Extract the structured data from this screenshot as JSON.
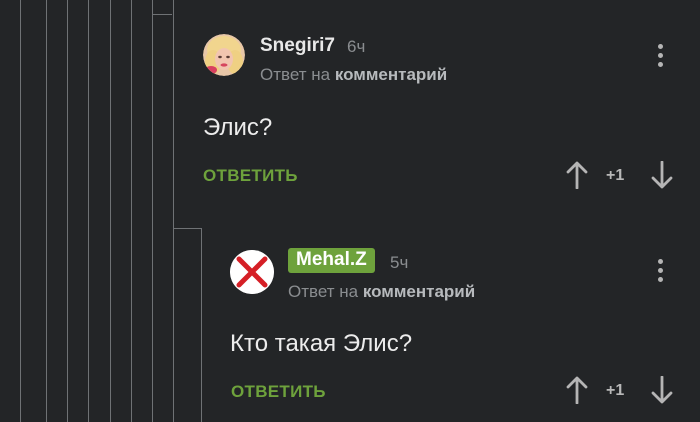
{
  "comments": [
    {
      "username": "Snegiri7",
      "time": "6ч",
      "reply_prefix": "Ответ на",
      "reply_target": "комментарий",
      "text": "Элис?",
      "reply_label": "ОТВЕТИТЬ",
      "score": "+1",
      "avatar_icon": "user-photo-avatar"
    },
    {
      "username": "Mehal.Z",
      "username_badge_color": "#6ea23c",
      "time": "5ч",
      "reply_prefix": "Ответ на",
      "reply_target": "комментарий",
      "text": "Кто такая Элис?",
      "reply_label": "ОТВЕТИТЬ",
      "score": "+1",
      "avatar_icon": "red-x-avatar-icon"
    }
  ],
  "colors": {
    "background": "#232527",
    "accent": "#6ea23c",
    "thread_line": "#6f7275"
  }
}
